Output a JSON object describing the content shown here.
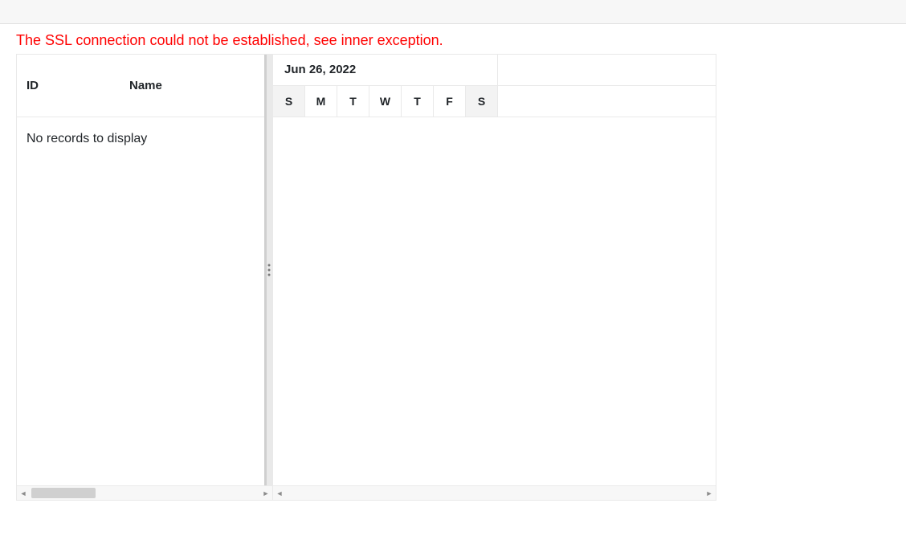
{
  "error_text": "The SSL connection could not be established, see inner exception.",
  "grid": {
    "columns": {
      "id": "ID",
      "name": "Name"
    },
    "empty_message": "No records to display"
  },
  "timeline": {
    "range_label": "Jun 26, 2022",
    "days": [
      {
        "abbr": "S",
        "weekend": true
      },
      {
        "abbr": "M",
        "weekend": false
      },
      {
        "abbr": "T",
        "weekend": false
      },
      {
        "abbr": "W",
        "weekend": false
      },
      {
        "abbr": "T",
        "weekend": false
      },
      {
        "abbr": "F",
        "weekend": false
      },
      {
        "abbr": "S",
        "weekend": true
      }
    ]
  }
}
